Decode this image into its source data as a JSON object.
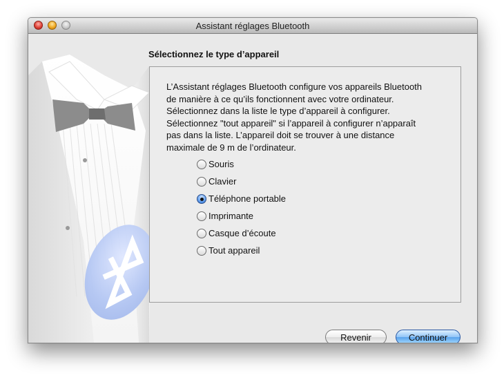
{
  "window": {
    "title": "Assistant réglages Bluetooth"
  },
  "page": {
    "heading": "Sélectionnez le type d’appareil",
    "description_lines": [
      "L’Assistant réglages Bluetooth configure vos appareils Bluetooth",
      "de manière à ce qu’ils fonctionnent avec votre ordinateur.",
      "Sélectionnez dans la liste le type d’appareil à configurer.",
      "Sélectionnez \"tout appareil\" si l’appareil à configurer n’apparaît",
      "pas dans la liste. L’appareil doit se trouver à une distance",
      "maximale de 9 m de l’ordinateur."
    ]
  },
  "device_types": [
    {
      "label": "Souris",
      "selected": false
    },
    {
      "label": "Clavier",
      "selected": false
    },
    {
      "label": "Téléphone portable",
      "selected": true
    },
    {
      "label": "Imprimante",
      "selected": false
    },
    {
      "label": "Casque d’écoute",
      "selected": false
    },
    {
      "label": "Tout appareil",
      "selected": false
    }
  ],
  "buttons": {
    "back_label": "Revenir",
    "continue_label": "Continuer"
  },
  "colors": {
    "accent": "#5aa2ec",
    "bluetooth_logo": "#b3c6f3"
  }
}
